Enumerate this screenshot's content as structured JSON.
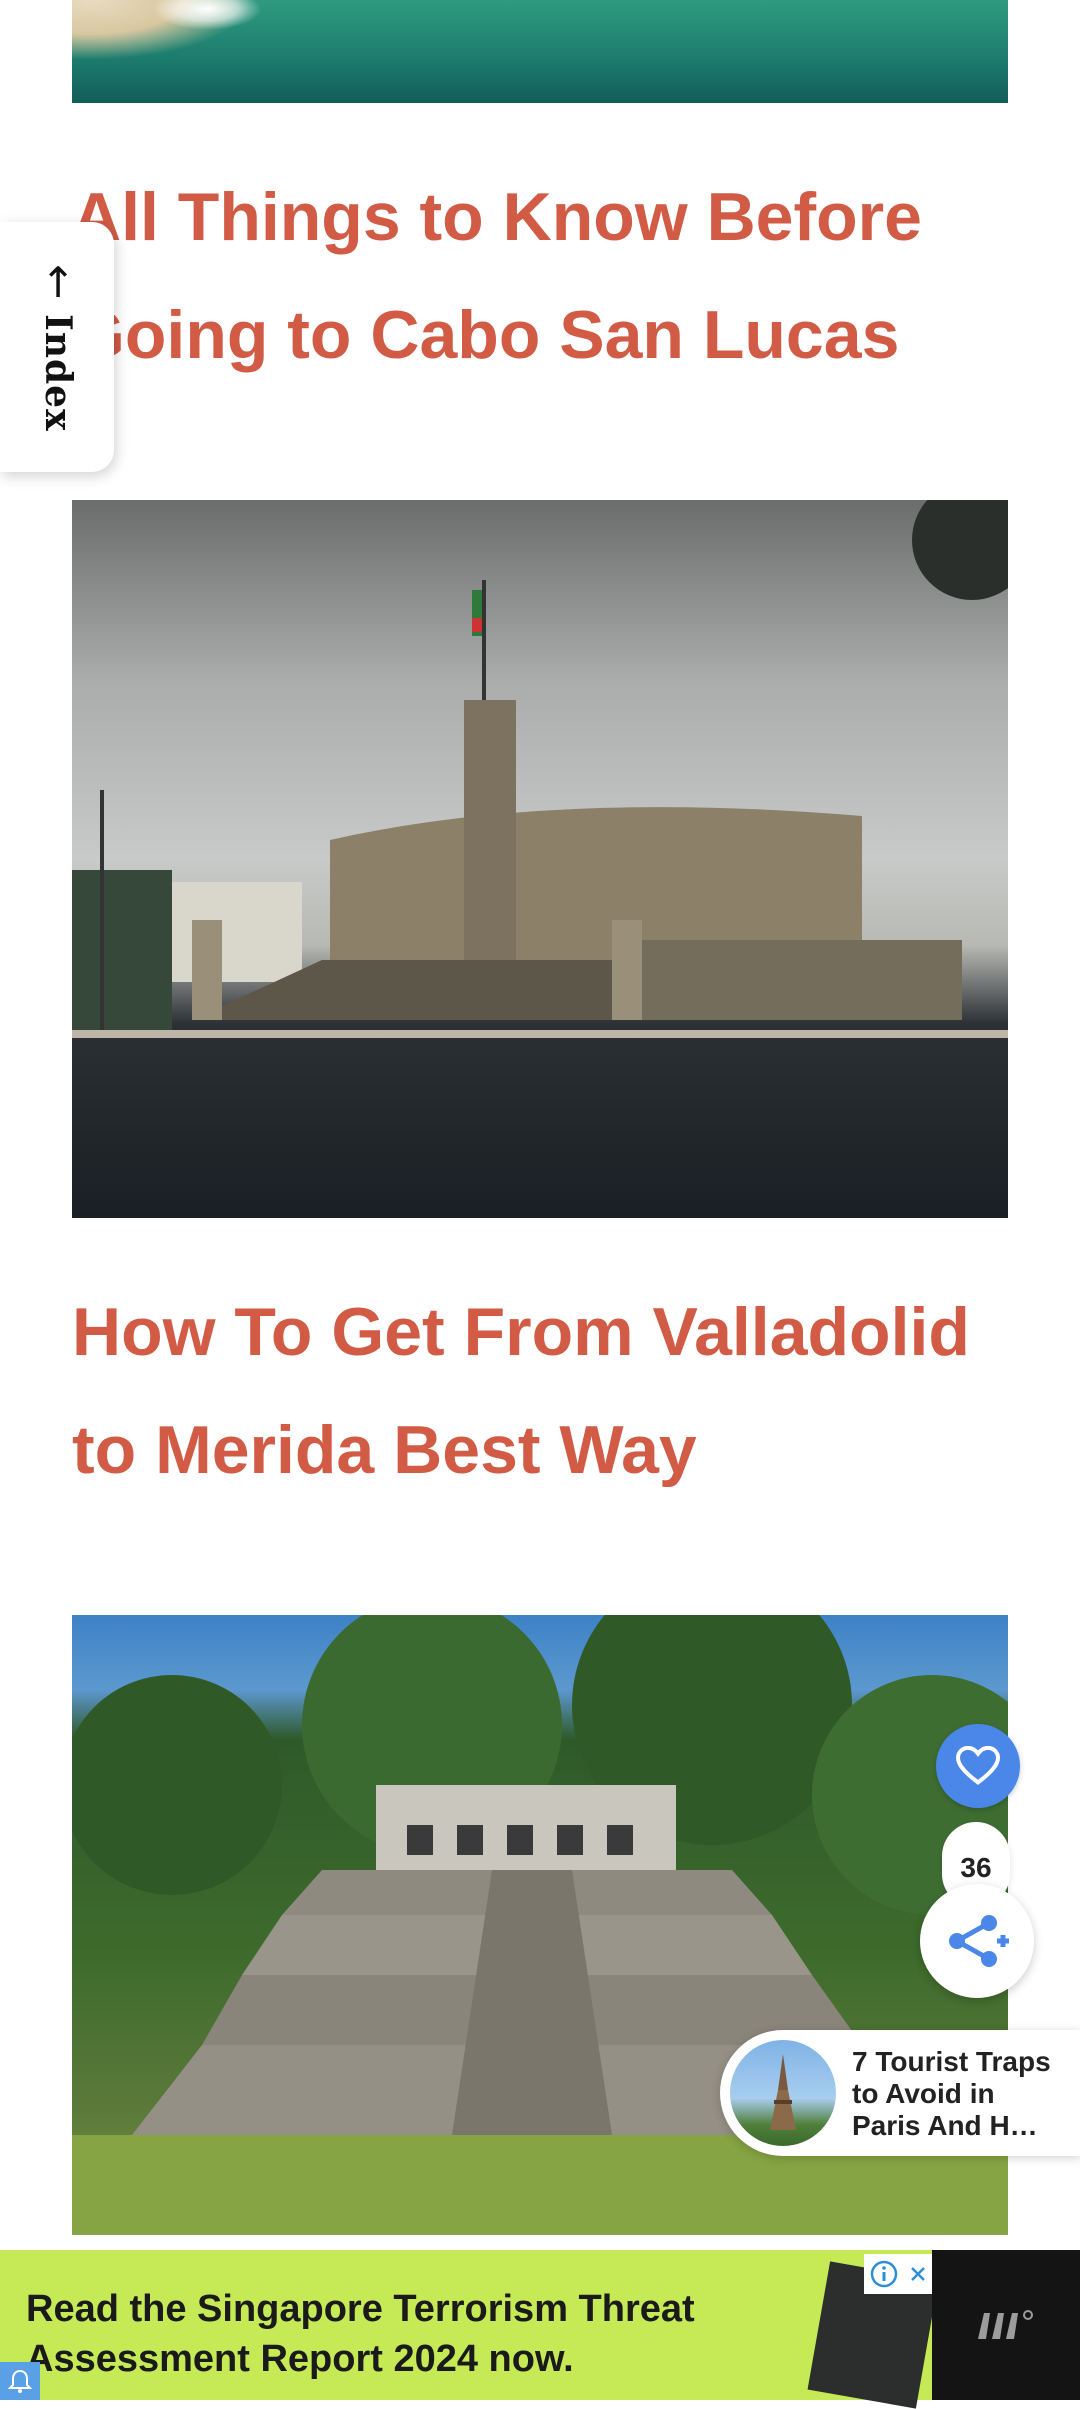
{
  "articles": [
    {
      "title": "All Things to Know Before Going to Cabo San Lucas"
    },
    {
      "title": "How To Get From Valladolid to Merida Best Way"
    }
  ],
  "index_tab": {
    "arrow": "↑",
    "label": "Index"
  },
  "floating": {
    "like_count": "36",
    "accent_color": "#4a87e8"
  },
  "recommendation": {
    "title": "7 Tourist Traps\nto Avoid in\nParis And H…"
  },
  "ad": {
    "text": "Read the Singapore Terrorism Threat Assessment Report 2024 now.",
    "background": "#c5ea56"
  },
  "colors": {
    "headline": "#d15b45"
  }
}
